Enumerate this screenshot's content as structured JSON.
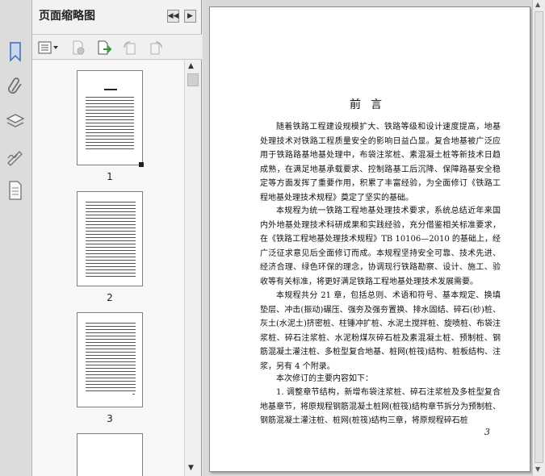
{
  "panel": {
    "title": "页面缩略图",
    "thumbnails": [
      {
        "label": "1"
      },
      {
        "label": "2"
      },
      {
        "label": "3"
      }
    ]
  },
  "document": {
    "title": "前言",
    "paragraphs": [
      "随着铁路工程建设规模扩大、铁路等级和设计速度提高，地基处理技术对铁路工程质量安全的影响日益凸显。复合地基被广泛应用于铁路路基地基处理中，布袋注浆桩、素混凝土桩等新技术日趋成熟，在满足地基承载要求、控制路基工后沉降、保障路基安全稳定等方面发挥了重要作用，积累了丰富经验，为全面修订《铁路工程地基处理技术规程》奠定了坚实的基础。",
      "本规程为统一铁路工程地基处理技术要求，系统总结近年来国内外地基处理技术科研成果和实践经验，充分借鉴相关标准要求，在《铁路工程地基处理技术规程》TB 10106—2010 的基础上，经广泛征求意见后全面修订而成。本规程坚持安全可靠、技术先进、经济合理、绿色环保的理念，协调现行铁路勘察、设计、施工、验收等有关标准，将更好满足铁路工程地基处理技术发展需要。",
      "本规程共分 21 章，包括总则、术语和符号、基本规定、换填垫层、冲击(振动)碾压、强夯及强夯置换、排水固结、碎石(砂)桩、灰土(水泥土)挤密桩、柱锤冲扩桩、水泥土搅拌桩、旋喷桩、布袋注浆桩、碎石注浆桩、水泥粉煤灰碎石桩及素混凝土桩、预制桩、钢筋混凝土灌注桩、多桩型复合地基、桩网(桩筏)结构、桩板结构、注浆，另有 4 个附录。",
      "本次修订的主要内容如下：",
      "1. 调整章节结构，新增布袋注浆桩、碎石注浆桩及多桩型复合地基章节，将原规程钢筋混凝土桩网(桩筏)结构章节拆分为预制桩、钢筋混凝土灌注桩、桩网(桩筏)结构三章，将原规程碎石桩"
    ],
    "page_number": "3"
  },
  "colors": {
    "panel_bg": "#f2f2f2",
    "doc_bg": "#d9d9d9",
    "icon_blue": "#3b6db5",
    "icon_gray": "#9a9a9a"
  },
  "icons": [
    "bookmark-icon",
    "attachment-icon",
    "layers-icon",
    "signature-icon",
    "document-icon",
    "options-icon",
    "delete-page-icon",
    "insert-page-icon",
    "rotate-left-icon",
    "rotate-right-icon"
  ]
}
